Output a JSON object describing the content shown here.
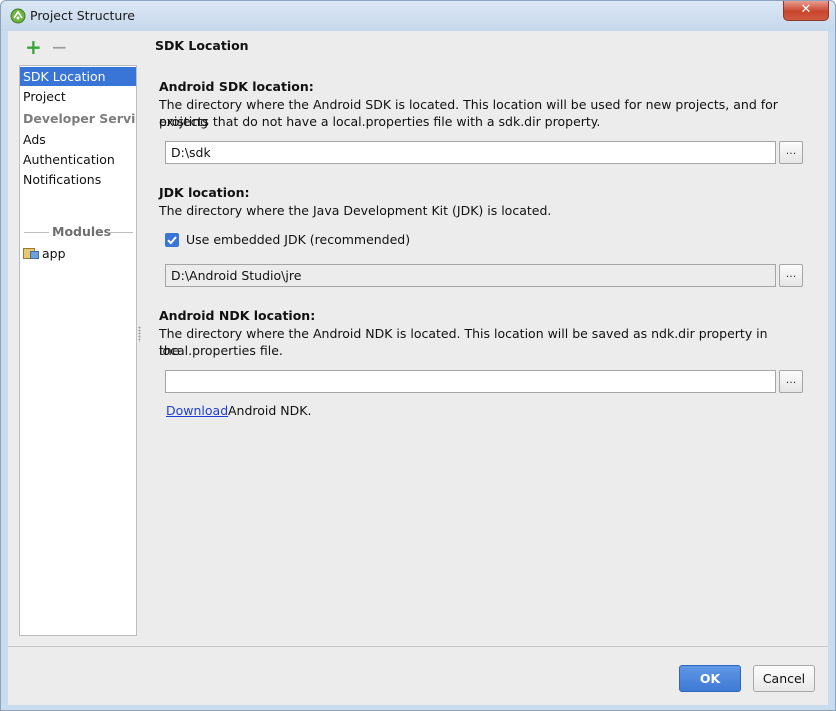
{
  "window": {
    "title": "Project Structure",
    "close_label": "✕"
  },
  "sidebar": {
    "add_icon": "+",
    "remove_icon": "−",
    "items": [
      {
        "label": "SDK Location",
        "selected": true
      },
      {
        "label": "Project"
      }
    ],
    "group_label": "Developer Servic...",
    "service_items": [
      {
        "label": "Ads"
      },
      {
        "label": "Authentication"
      },
      {
        "label": "Notifications"
      }
    ],
    "modules_label": "Modules",
    "modules": [
      {
        "label": "app"
      }
    ]
  },
  "main": {
    "section_title": "SDK Location",
    "sdk": {
      "label": "Android SDK location:",
      "desc_line1": "The directory where the Android SDK is located. This location will be used for new projects, and for existing",
      "desc_line2": "projects that do not have a local.properties file with a sdk.dir property.",
      "value": "D:\\sdk",
      "browse": "..."
    },
    "jdk": {
      "label": "JDK location:",
      "desc": "The directory where the Java Development Kit (JDK) is located.",
      "checkbox_label": "Use embedded JDK (recommended)",
      "checkbox_checked": true,
      "value": "D:\\Android Studio\\jre",
      "browse": "..."
    },
    "ndk": {
      "label": "Android NDK location:",
      "desc_line1": "The directory where the Android NDK is located. This location will be saved as ndk.dir property in the",
      "desc_line2": "local.properties file.",
      "value": "",
      "browse": "...",
      "download_link": "Download",
      "download_rest": "Android NDK."
    }
  },
  "footer": {
    "ok_label": "OK",
    "cancel_label": "Cancel"
  },
  "colors": {
    "selection": "#3875d7",
    "ok_button": "#4a86dc",
    "link": "#1f3fd4",
    "add_icon": "#3aa53a"
  }
}
